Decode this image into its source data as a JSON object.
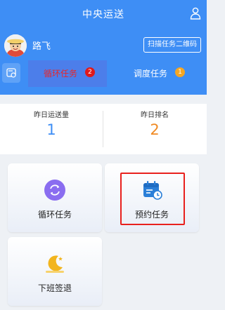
{
  "header": {
    "title": "中央运送"
  },
  "user": {
    "name": "路飞"
  },
  "scan_button": "扫描任务二维码",
  "tabs": [
    {
      "label": "循环任务",
      "badge": "2",
      "badge_color": "#e0191b",
      "active": true
    },
    {
      "label": "调度任务",
      "badge": "1",
      "badge_color": "#f5a623",
      "active": false
    }
  ],
  "stats": {
    "yesterday_volume": {
      "label": "昨日运送量",
      "value": "1",
      "color": "#3e8ef5"
    },
    "yesterday_rank": {
      "label": "昨日排名",
      "value": "2",
      "color": "#f08a24"
    }
  },
  "cards": [
    {
      "label": "循环任务",
      "icon": "refresh-icon",
      "icon_color": "#8a6df0"
    },
    {
      "label": "预约任务",
      "icon": "calendar-clock-icon",
      "icon_color": "#2b7fd8"
    },
    {
      "label": "下班签退",
      "icon": "moon-icon",
      "icon_color": "#f2b51e"
    }
  ],
  "colors": {
    "primary": "#3e8ef5",
    "highlight": "#e8201d"
  }
}
